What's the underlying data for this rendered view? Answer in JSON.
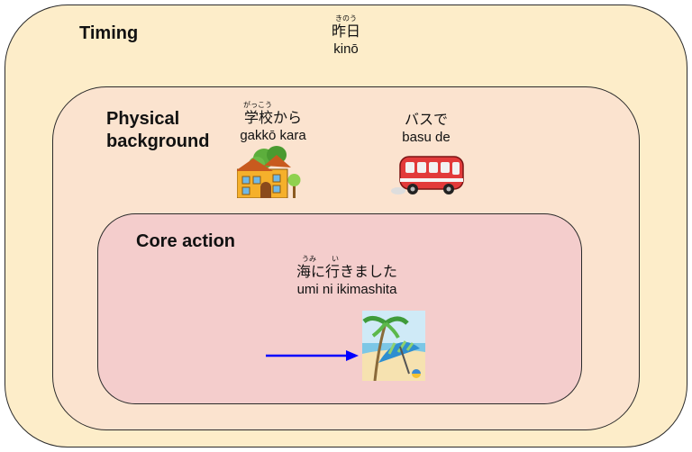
{
  "timing": {
    "title": "Timing",
    "ruby": "きのう",
    "japanese": "昨日",
    "romaji": "kinō"
  },
  "physical": {
    "title": "Physical background",
    "school": {
      "ruby": "がっこう",
      "japanese": "学校から",
      "romaji": "gakkō kara",
      "icon": "school-house"
    },
    "bus": {
      "japanese": "バスで",
      "romaji": "basu de",
      "icon": "red-bus"
    }
  },
  "core": {
    "title": "Core action",
    "ruby_umi": "うみ",
    "ruby_i": "い",
    "japanese": "海に行きました",
    "romaji": "umi ni ikimashita",
    "icon": "beach-umbrella",
    "arrow_color": "#0000ff"
  },
  "colors": {
    "outer": "#fdedc9",
    "middle": "#fbe3cf",
    "inner": "#f4cdcc"
  }
}
